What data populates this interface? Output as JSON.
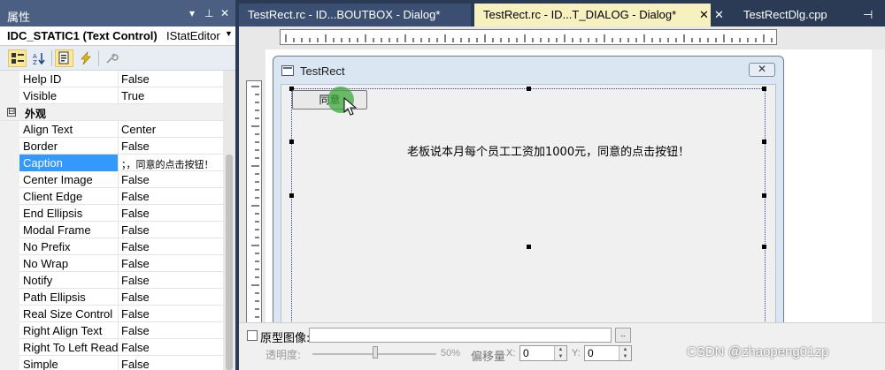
{
  "properties_panel": {
    "title": "属性",
    "object_name": "IDC_STATIC1 (Text Control)",
    "object_type": "IStatEditor",
    "rows_top": [
      {
        "name": "Help ID",
        "value": "False"
      },
      {
        "name": "Visible",
        "value": "True"
      }
    ],
    "category": {
      "toggle": "⊟",
      "name": "外观"
    },
    "rows": [
      {
        "name": "Align Text",
        "value": "Center"
      },
      {
        "name": "Border",
        "value": "False"
      },
      {
        "name": "Caption",
        "value": "；，同意的点击按钮！",
        "selected": true
      },
      {
        "name": "Center Image",
        "value": "False"
      },
      {
        "name": "Client Edge",
        "value": "False"
      },
      {
        "name": "End Ellipsis",
        "value": "False"
      },
      {
        "name": "Modal Frame",
        "value": "False"
      },
      {
        "name": "No Prefix",
        "value": "False"
      },
      {
        "name": "No Wrap",
        "value": "False"
      },
      {
        "name": "Notify",
        "value": "False"
      },
      {
        "name": "Path Ellipsis",
        "value": "False"
      },
      {
        "name": "Real Size Control",
        "value": "False"
      },
      {
        "name": "Right Align Text",
        "value": "False"
      },
      {
        "name": "Right To Left Reading",
        "value": "False"
      },
      {
        "name": "Simple",
        "value": "False"
      }
    ]
  },
  "tabs": [
    {
      "label": "TestRect.rc - ID...BOUTBOX - Dialog*",
      "state": "inactive"
    },
    {
      "label": "TestRect.rc - ID...T_DIALOG - Dialog*",
      "state": "active"
    },
    {
      "label": "TestRectDlg.cpp",
      "state": "inactive"
    }
  ],
  "dialog": {
    "title": "TestRect",
    "close_glyph": "✕",
    "button_label": "同意",
    "static_text": "老板说本月每个员工工资加1000元，同意的点击按钮！"
  },
  "overlay": {
    "prototype_label": "原型图像:",
    "browse_label": "..",
    "opacity_label": "透明度:",
    "opacity_percent": "50%",
    "opacity_value": 0.5,
    "offset_label": "偏移量",
    "x_label": "X:",
    "x_value": "0",
    "y_label": "Y:",
    "y_value": "0"
  },
  "watermark": "CSDN @zhaopeng01zp",
  "colors": {
    "titlebar": "#4a5f82",
    "active_tab": "#f7f1c0",
    "selection": "#3399ff",
    "ide_background": "#2b3a55"
  }
}
